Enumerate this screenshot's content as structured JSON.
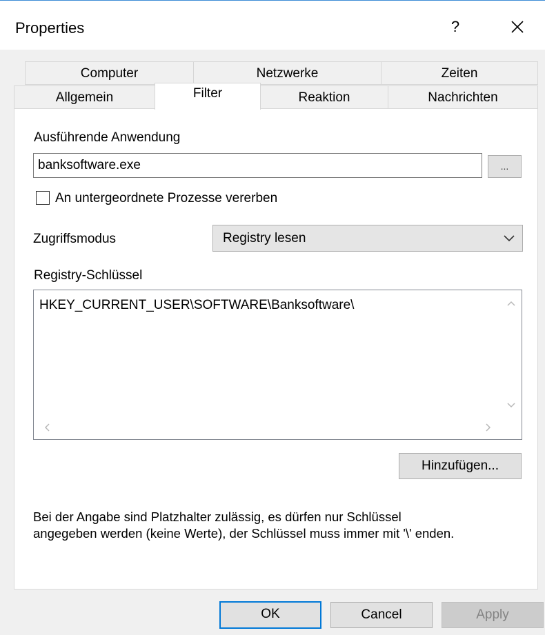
{
  "window": {
    "title": "Properties",
    "help_label": "?",
    "close_icon": "close-icon"
  },
  "tabs": {
    "row_back": [
      {
        "label": "Computer"
      },
      {
        "label": "Netzwerke"
      },
      {
        "label": "Zeiten"
      }
    ],
    "row_front": [
      {
        "label": "Allgemein"
      },
      {
        "label": "Filter",
        "selected": true
      },
      {
        "label": "Reaktion"
      },
      {
        "label": "Nachrichten"
      }
    ]
  },
  "filter": {
    "application_label": "Ausführende Anwendung",
    "application_value": "banksoftware.exe",
    "browse_label": "...",
    "inherit_label": "An untergeordnete Prozesse vererben",
    "inherit_checked": false,
    "access_mode_label": "Zugriffsmodus",
    "access_mode_value": "Registry lesen",
    "registry_label": "Registry-Schlüssel",
    "registry_entries": [
      "HKEY_CURRENT_USER\\SOFTWARE\\Banksoftware\\"
    ],
    "add_label": "Hinzufügen...",
    "hint_line1": "Bei der Angabe sind Platzhalter zulässig, es dürfen nur Schlüssel",
    "hint_line2": "angegeben werden (keine Werte), der Schlüssel muss immer mit '\\' enden."
  },
  "footer": {
    "ok_label": "OK",
    "cancel_label": "Cancel",
    "apply_label": "Apply"
  },
  "colors": {
    "accent": "#0078d7",
    "panel_background": "#ffffff",
    "window_background": "#f0f0f0",
    "disabled_text": "#838383"
  }
}
